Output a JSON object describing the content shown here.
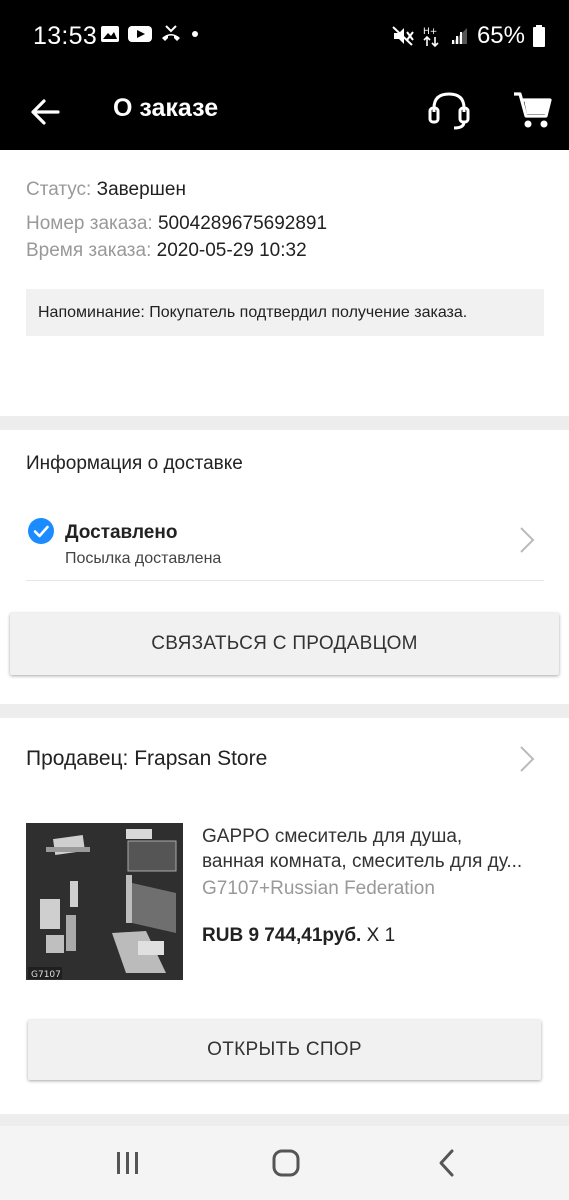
{
  "status_bar": {
    "time": "13:53",
    "battery": "65%",
    "left_icons": [
      "gallery-icon",
      "youtube-icon",
      "missed-call-icon",
      "dot-icon"
    ],
    "right_icons": [
      "mute-icon",
      "data-icon",
      "signal-icon",
      "battery-icon"
    ]
  },
  "app_bar": {
    "title": "О заказе",
    "icons": [
      "back-arrow-icon",
      "headset-icon",
      "cart-icon"
    ]
  },
  "order": {
    "status_label": "Статус:",
    "status_value": "Завершен",
    "number_label": "Номер заказа:",
    "number_value": "5004289675692891",
    "time_label": "Время заказа:",
    "time_value": "2020-05-29 10:32",
    "reminder": "Напоминание: Покупатель подтвердил получение заказа."
  },
  "delivery": {
    "title": "Информация о доставке",
    "status": "Доставлено",
    "substatus": "Посылка доставлена",
    "contact_button": "СВЯЗАТЬСЯ С ПРОДАВЦОМ",
    "check_color": "#1a8cff"
  },
  "seller": {
    "title": "Продавец: Frapsan Store",
    "product": {
      "title_line1": "GAPPO смеситель для душа,",
      "title_line2": "ванная комната, смеситель для ду...",
      "variant": "G7107+Russian Federation",
      "price": "RUB 9 744,41руб.",
      "qty": "X 1",
      "image_label": "G7107"
    },
    "dispute_button": "ОТКРЫТЬ СПОР"
  },
  "nav": {
    "icons": [
      "recents-icon",
      "home-icon",
      "back-icon"
    ]
  }
}
